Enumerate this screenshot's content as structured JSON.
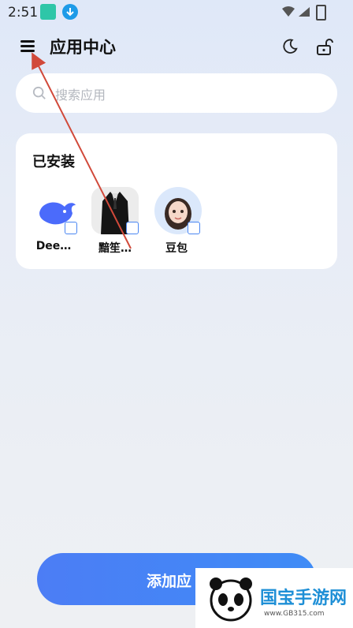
{
  "status_bar": {
    "time": "2:51"
  },
  "header": {
    "title": "应用中心"
  },
  "search": {
    "placeholder": "搜索应用"
  },
  "installed": {
    "title": "已安装",
    "apps": [
      {
        "label": "Dee…"
      },
      {
        "label": "黯笙…"
      },
      {
        "label": "豆包"
      }
    ]
  },
  "bottom": {
    "add_label": "添加应"
  },
  "watermark": {
    "text": "国宝手游网",
    "url": "www.GB315.com"
  },
  "colors": {
    "accent": "#4c7df5",
    "annotation": "#d1493a"
  }
}
